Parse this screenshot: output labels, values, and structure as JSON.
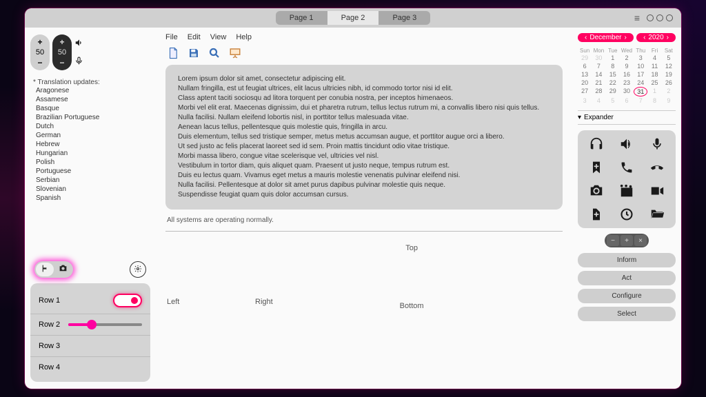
{
  "tabs": [
    "Page 1",
    "Page 2",
    "Page 3"
  ],
  "active_tab": 1,
  "spinners": {
    "light": "50",
    "dark": "50"
  },
  "menubar": [
    "File",
    "Edit",
    "View",
    "Help"
  ],
  "list": {
    "header": "* Translation updates:",
    "items": [
      "Aragonese",
      "Assamese",
      "Basque",
      "Brazilian Portuguese",
      "Dutch",
      "German",
      "Hebrew",
      "Hungarian",
      "Polish",
      "Portuguese",
      "Serbian",
      "Slovenian",
      "Spanish"
    ]
  },
  "rows": [
    "Row 1",
    "Row 2",
    "Row 3",
    "Row 4"
  ],
  "lorem": [
    "Lorem ipsum dolor sit amet, consectetur adipiscing elit.",
    "Nullam fringilla, est ut feugiat ultrices, elit lacus ultricies nibh, id commodo tortor nisi id elit.",
    "Class aptent taciti sociosqu ad litora torquent per conubia nostra, per inceptos himenaeos.",
    "Morbi vel elit erat. Maecenas dignissim, dui et pharetra rutrum, tellus lectus rutrum mi, a convallis libero nisi quis tellus.",
    "Nulla facilisi. Nullam eleifend lobortis nisl, in porttitor tellus malesuada vitae.",
    "Aenean lacus tellus, pellentesque quis molestie quis, fringilla in arcu.",
    "Duis elementum, tellus sed tristique semper, metus metus accumsan augue, et porttitor augue orci a libero.",
    "Ut sed justo ac felis placerat laoreet sed id sem. Proin mattis tincidunt odio vitae tristique.",
    "Morbi massa libero, congue vitae scelerisque vel, ultricies vel nisl.",
    "Vestibulum in tortor diam, quis aliquet quam. Praesent ut justo neque, tempus rutrum est.",
    "Duis eu lectus quam. Vivamus eget metus a mauris molestie venenatis pulvinar eleifend nisi.",
    "Nulla facilisi. Pellentesque at dolor sit amet purus dapibus pulvinar molestie quis neque.",
    "Suspendisse feugiat quam quis dolor accumsan cursus."
  ],
  "status": "All systems are operating normally.",
  "compass": {
    "top": "Top",
    "bottom": "Bottom",
    "left": "Left",
    "right": "Right"
  },
  "calendar": {
    "month": "December",
    "year": "2020",
    "dow": [
      "Sun",
      "Mon",
      "Tue",
      "Wed",
      "Thu",
      "Fri",
      "Sat"
    ],
    "lead_dim": [
      "29",
      "30"
    ],
    "days": [
      "1",
      "2",
      "3",
      "4",
      "5",
      "6",
      "7",
      "8",
      "9",
      "10",
      "11",
      "12",
      "13",
      "14",
      "15",
      "16",
      "17",
      "18",
      "19",
      "20",
      "21",
      "22",
      "23",
      "24",
      "25",
      "26",
      "27",
      "28",
      "29",
      "30",
      "31"
    ],
    "trail_dim": [
      "1",
      "2",
      "3",
      "4",
      "5",
      "6",
      "7",
      "8",
      "9"
    ],
    "today": "31"
  },
  "expander": "Expander",
  "actions": [
    "Inform",
    "Act",
    "Configure",
    "Select"
  ]
}
